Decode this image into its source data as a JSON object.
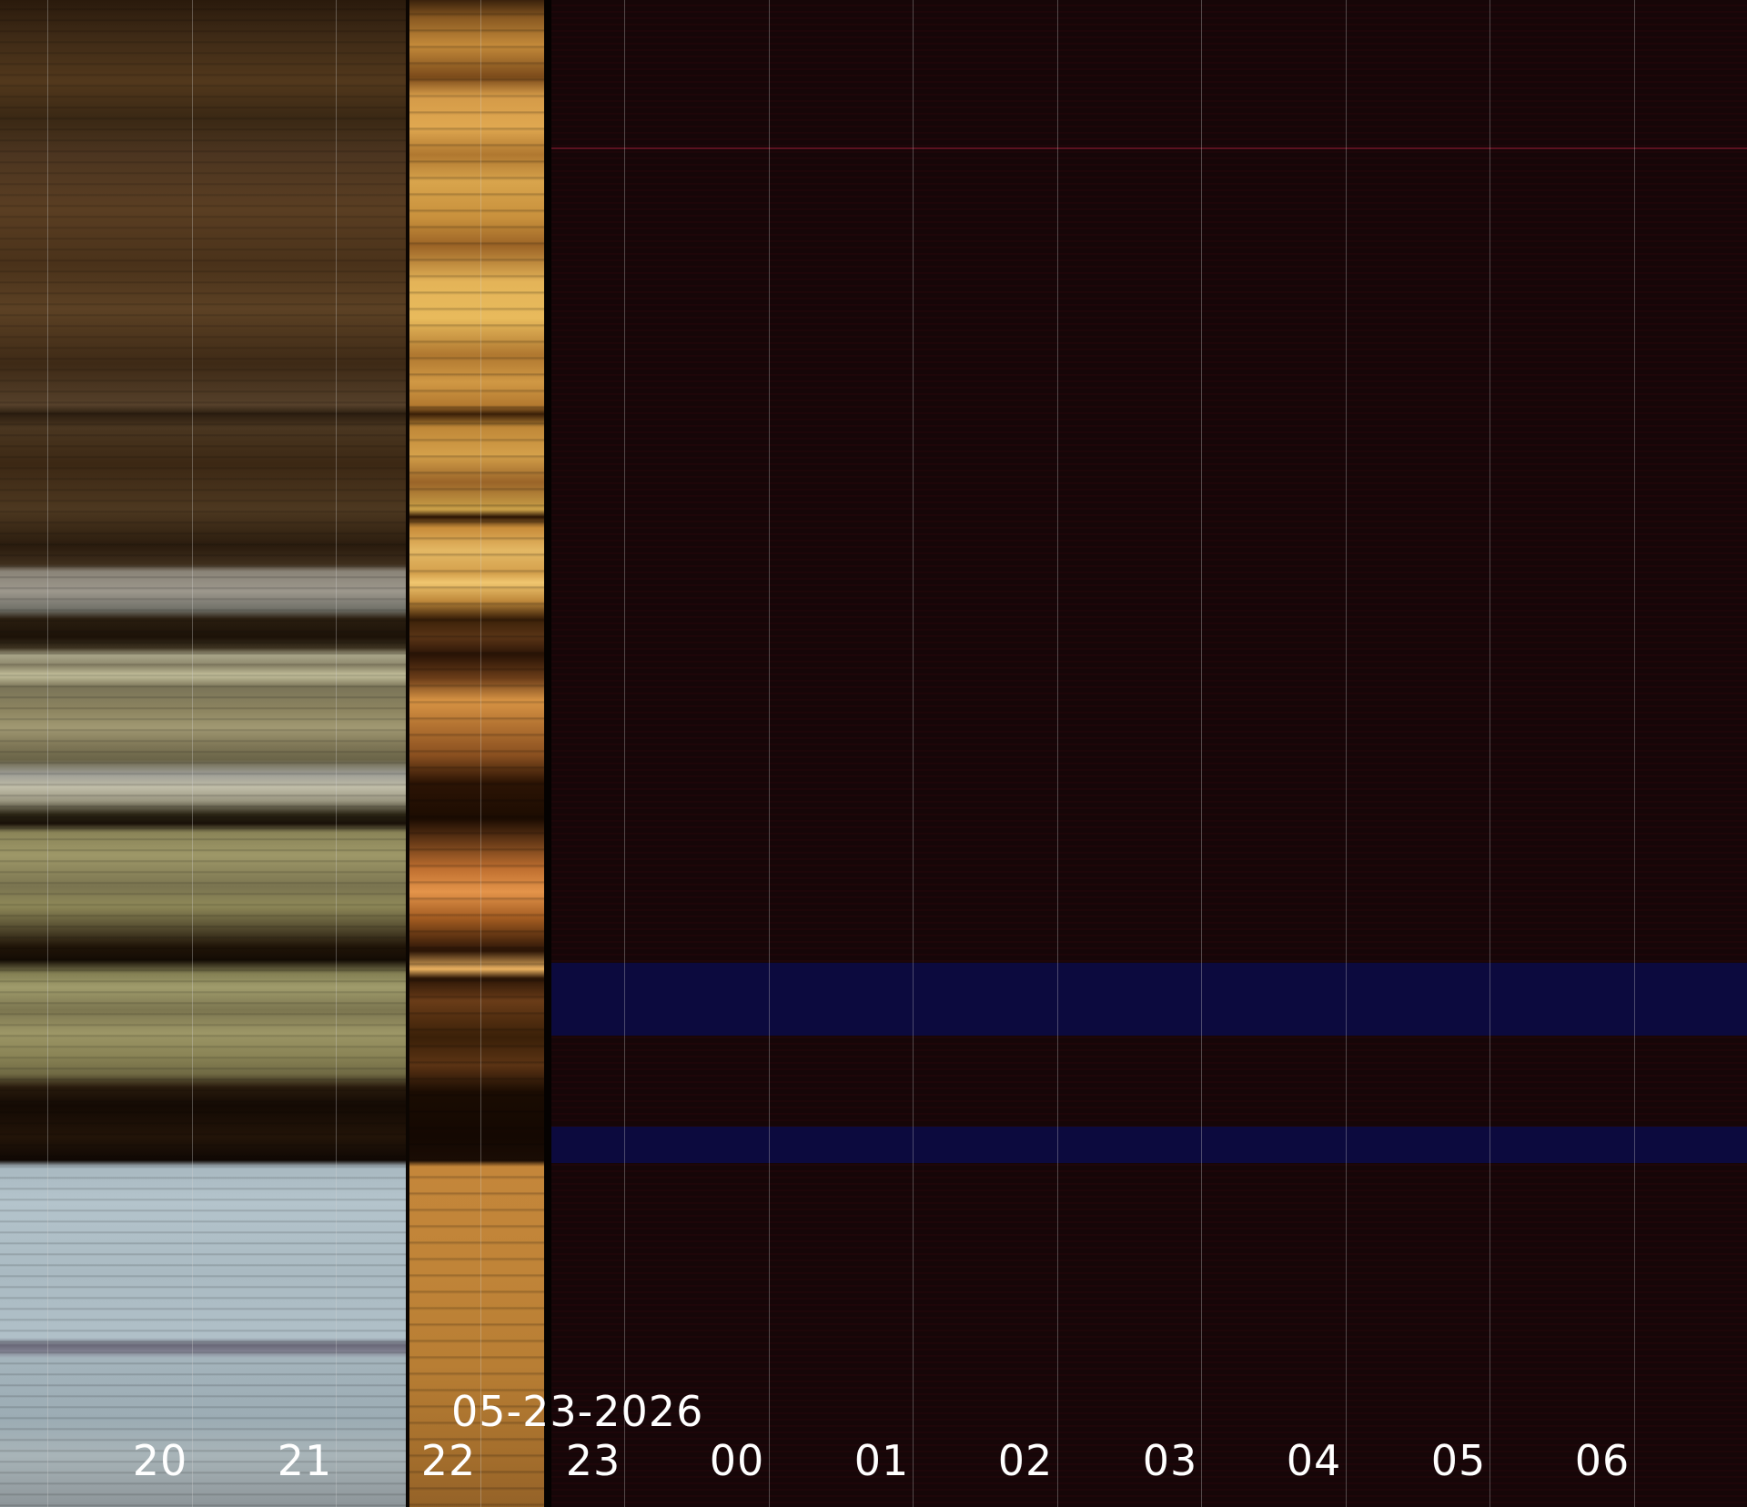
{
  "image": {
    "kind": "keogram",
    "date_label": "05-23-2026",
    "hour_labels": [
      "20",
      "21",
      "22",
      "23",
      "00",
      "01",
      "02",
      "03",
      "04",
      "05",
      "06"
    ],
    "panels": [
      {
        "name": "day",
        "color": "#5a3e22"
      },
      {
        "name": "twilight",
        "color": "#d49a48"
      },
      {
        "name": "night",
        "color": "#160608"
      }
    ],
    "accent_colors": {
      "night_blue_band": "#0c0a3e",
      "night_red_line": "#5a1220",
      "label_text": "#ffffff"
    }
  }
}
